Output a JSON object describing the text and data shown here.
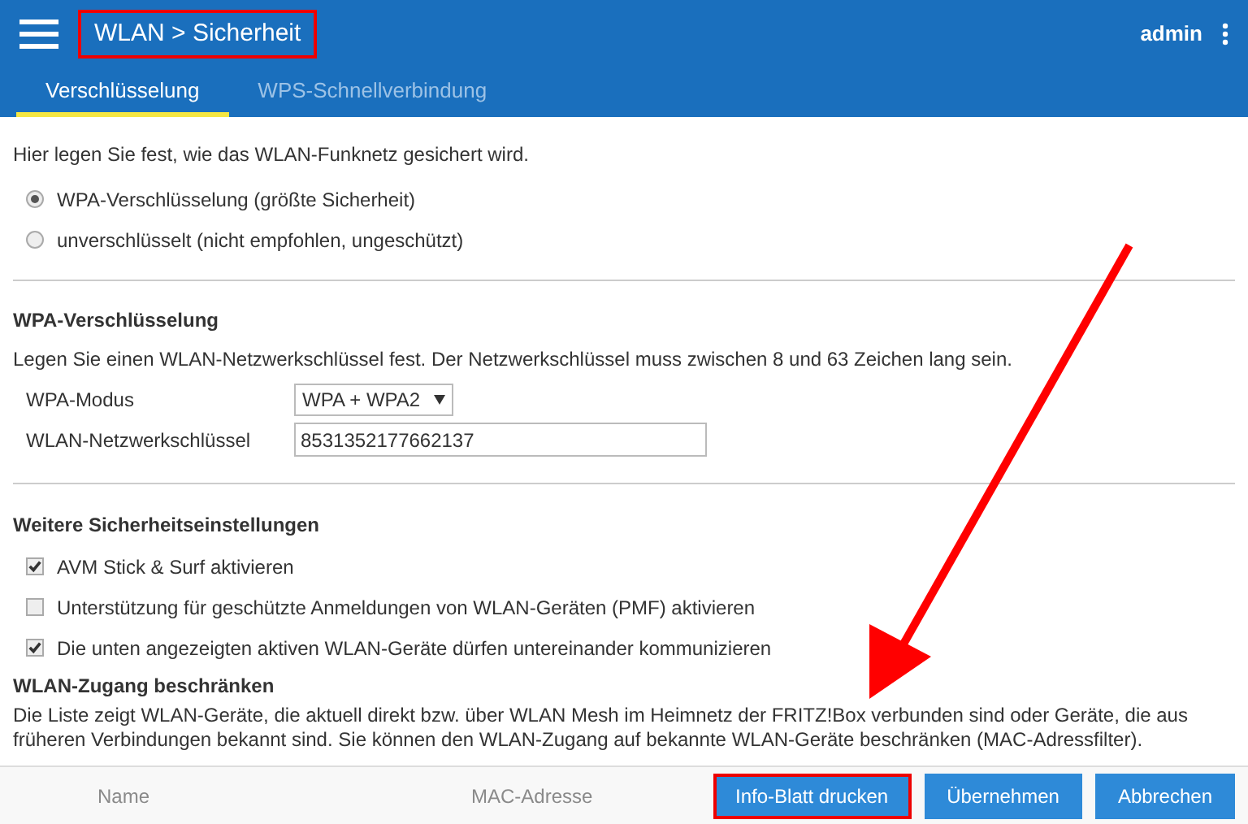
{
  "header": {
    "breadcrumb": [
      "WLAN",
      "Sicherheit"
    ],
    "separator": ">",
    "user": "admin"
  },
  "tabs": [
    {
      "label": "Verschlüsselung",
      "selected": true
    },
    {
      "label": "WPS-Schnellverbindung",
      "selected": false
    }
  ],
  "intro": "Hier legen Sie fest, wie das WLAN-Funknetz gesichert wird.",
  "radios": [
    {
      "label": "WPA-Verschlüsselung (größte Sicherheit)",
      "selected": true
    },
    {
      "label": "unverschlüsselt (nicht empfohlen, ungeschützt)",
      "selected": false
    }
  ],
  "wpa": {
    "heading": "WPA-Verschlüsselung",
    "description": "Legen Sie einen WLAN-Netzwerkschlüssel fest. Der Netzwerkschlüssel muss zwischen 8 und 63 Zeichen lang sein.",
    "mode_label": "WPA-Modus",
    "mode_value": "WPA + WPA2",
    "key_label": "WLAN-Netzwerkschlüssel",
    "key_value": "8531352177662137"
  },
  "security": {
    "heading": "Weitere Sicherheitseinstellungen",
    "options": [
      {
        "label": "AVM Stick & Surf aktivieren",
        "checked": true
      },
      {
        "label": "Unterstützung für geschützte Anmeldungen von WLAN-Geräten (PMF) aktivieren",
        "checked": false
      },
      {
        "label": "Die unten angezeigten aktiven WLAN-Geräte dürfen untereinander kommunizieren",
        "checked": true
      }
    ]
  },
  "access": {
    "heading": "WLAN-Zugang beschränken",
    "description": "Die Liste zeigt WLAN-Geräte, die aktuell direkt bzw. über WLAN Mesh im Heimnetz der FRITZ!Box verbunden sind oder Geräte, die aus früheren Verbindungen bekannt sind. Sie können den WLAN-Zugang auf bekannte WLAN-Geräte beschränken (MAC-Adressfilter).",
    "columns": [
      "Name",
      "MAC-Adresse"
    ]
  },
  "buttons": [
    {
      "label": "Info-Blatt drucken",
      "highlighted": true
    },
    {
      "label": "Übernehmen",
      "highlighted": false
    },
    {
      "label": "Abbrechen",
      "highlighted": false
    }
  ]
}
